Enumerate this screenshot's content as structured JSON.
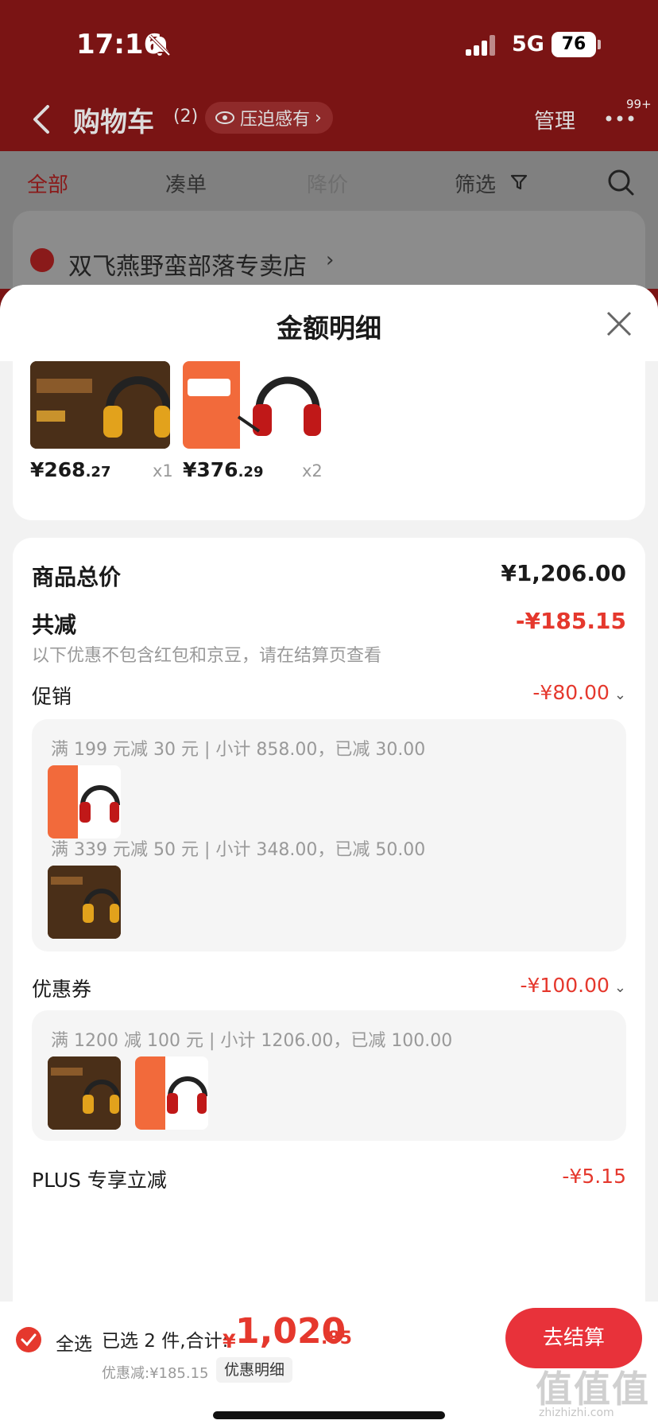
{
  "status": {
    "time": "17:16",
    "network": "5G",
    "battery": "76"
  },
  "header": {
    "title": "购物车",
    "count": "(2)",
    "pressure_label": "压迫感有",
    "manage": "管理",
    "badge": "99+"
  },
  "tabs": {
    "all": "全部",
    "bundle": "凑单",
    "price_drop": "降价",
    "filter": "筛选"
  },
  "store": {
    "name": "双飞燕野蛮部落专卖店"
  },
  "sheet": {
    "title": "金额明细",
    "items": [
      {
        "price_int": "¥268",
        "price_dec": ".27",
        "qty": "x1",
        "thumb": "M595 headset"
      },
      {
        "price_int": "¥376",
        "price_dec": ".29",
        "qty": "x2",
        "thumb": "red headset"
      }
    ],
    "summary": {
      "goods_total_label": "商品总价",
      "goods_total_value": "¥1,206.00",
      "discount_label": "共减",
      "discount_value": "-¥185.15",
      "discount_note": "以下优惠不包含红包和京豆，请在结算页查看",
      "promo_label": "促销",
      "promo_value": "-¥80.00",
      "promo_groups": [
        {
          "text": "满 199 元减 30 元 | 小计 858.00，已减 30.00"
        },
        {
          "text": "满 339 元减 50 元 | 小计 348.00，已减 50.00"
        }
      ],
      "coupon_label": "优惠券",
      "coupon_value": "-¥100.00",
      "coupon_groups": [
        {
          "text": "满 1200 减 100 元 | 小计 1206.00，已减 100.00"
        }
      ],
      "plus_label": "PLUS 专享立减",
      "plus_value": "-¥5.15"
    }
  },
  "bottom": {
    "select_all": "全选",
    "selected": "已选 2 件,合计:",
    "total_yen": "¥",
    "total_int": "1,020",
    "total_dec": ".85",
    "saved": "优惠减:¥185.15",
    "detail_chip": "优惠明细",
    "checkout": "去结算"
  },
  "watermark": {
    "main": "值值值",
    "sub": "zhizhizhi.com"
  },
  "colors": {
    "brand_red": "#e5382d",
    "header_bg": "#7a1414"
  }
}
